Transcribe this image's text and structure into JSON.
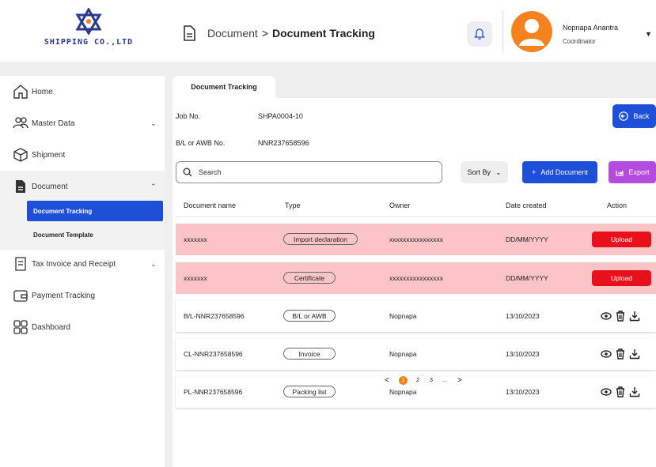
{
  "brand": {
    "name": "SHIPPING CO.,LTD"
  },
  "header": {
    "breadcrumb_root": "Document",
    "breadcrumb_sep": ">",
    "breadcrumb_current": "Document Tracking",
    "user_name": "Nopnapa Anantra",
    "user_role": "Coordinator"
  },
  "sidebar": {
    "items": [
      {
        "label": "Home",
        "icon": "home-icon"
      },
      {
        "label": "Master Data",
        "icon": "users-icon"
      },
      {
        "label": "Shipment",
        "icon": "box-icon"
      },
      {
        "label": "Document",
        "icon": "document-icon"
      },
      {
        "label": "Tax Invoice and Receipt",
        "icon": "receipt-icon"
      },
      {
        "label": "Payment Tracking",
        "icon": "wallet-icon"
      },
      {
        "label": "Dashboard",
        "icon": "grid-icon"
      }
    ],
    "sub_items": [
      "Document Tracking",
      "Document Template"
    ]
  },
  "main": {
    "tab": "Document Tracking",
    "job_no_label": "Job No.",
    "job_no_value": "SHPA0004-10",
    "bl_label": "B/L or AWB No.",
    "bl_value": "NNR237658596",
    "back_label": "Back",
    "search_placeholder": "Search",
    "sort_label": "Sort By",
    "add_label": "Add Document",
    "export_label": "Export",
    "columns": [
      "Document name",
      "Type",
      "Owner",
      "Date created",
      "Action"
    ],
    "upload_label": "Upload",
    "rows": [
      {
        "name": "xxxxxxx",
        "type": "Import declaration",
        "owner": "xxxxxxxxxxxxxxxx",
        "date": "DD/MM/YYYY",
        "status": "pending"
      },
      {
        "name": "xxxxxxx",
        "type": "Certificate",
        "owner": "xxxxxxxxxxxxxxxx",
        "date": "DD/MM/YYYY",
        "status": "pending"
      },
      {
        "name": "B/L-NNR237658596",
        "type": "B/L or AWB",
        "owner": "Nopnapa",
        "date": "13/10/2023",
        "status": "done"
      },
      {
        "name": "CL-NNR237658596",
        "type": "Invoice",
        "owner": "Nopnapa",
        "date": "13/10/2023",
        "status": "done"
      },
      {
        "name": "PL-NNR237658596",
        "type": "Packing list",
        "owner": "Nopnapa",
        "date": "13/10/2023",
        "status": "done"
      }
    ]
  },
  "pagination": {
    "prev": "<",
    "pages": [
      "1",
      "2",
      "3",
      "..."
    ],
    "next": ">",
    "current": "1"
  },
  "colors": {
    "primary": "#1e4fd9",
    "accent": "#f5821f",
    "danger": "#e8111b",
    "export": "#b34bde",
    "pending_row": "#fcc4c7"
  }
}
